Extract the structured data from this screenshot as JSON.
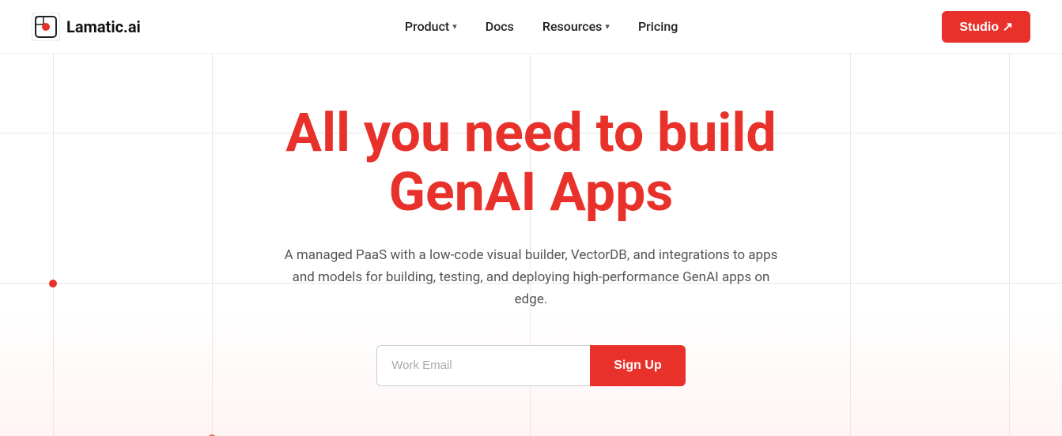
{
  "logo": {
    "text": "Lamatic.ai"
  },
  "nav": {
    "product_label": "Product",
    "docs_label": "Docs",
    "resources_label": "Resources",
    "pricing_label": "Pricing",
    "studio_label": "Studio ↗"
  },
  "hero": {
    "title_line1": "All you need to build",
    "title_line2": "GenAI Apps",
    "subtitle": "A managed PaaS with a low-code visual builder, VectorDB, and integrations to apps and models for building, testing, and deploying high-performance GenAI apps on edge.",
    "email_placeholder": "Work Email",
    "signup_label": "Sign Up"
  },
  "colors": {
    "accent": "#e8312a"
  }
}
